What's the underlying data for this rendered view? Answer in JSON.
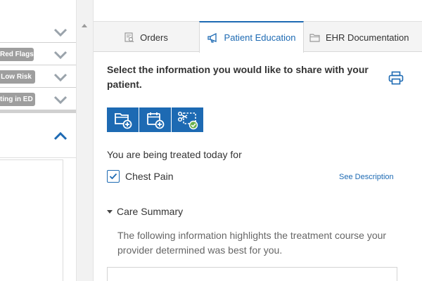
{
  "left_panel": {
    "badges": [
      "Red Flags",
      "Low Risk",
      "ting in ED"
    ]
  },
  "tabs": [
    {
      "label": "Orders",
      "icon": "orders-icon",
      "active": false
    },
    {
      "label": "Patient Education",
      "icon": "megaphone-icon",
      "active": true
    },
    {
      "label": "EHR Documentation",
      "icon": "folder-icon",
      "active": false
    }
  ],
  "education": {
    "prompt": "Select the information you would like to share with your patient.",
    "icon_buttons": [
      "folder-add-icon",
      "calendar-add-icon",
      "scissors-select-icon"
    ],
    "treated_for_label": "You are being treated today for",
    "diagnosis": {
      "label": "Chest Pain",
      "checked": true
    },
    "see_description": "See Description",
    "care_summary_label": "Care Summary",
    "care_summary_text": "The following information highlights the treatment course your provider determined was best for you."
  },
  "colors": {
    "accent": "#1d6ab3",
    "badge": "#9e9e9e",
    "check_green": "#6ab04c"
  }
}
